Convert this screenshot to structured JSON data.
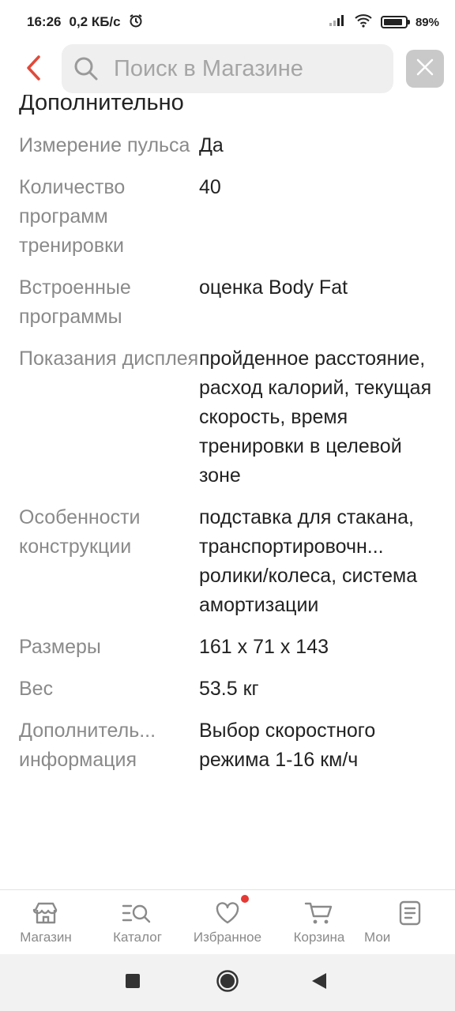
{
  "status_bar": {
    "time": "16:26",
    "net_speed": "0,2 КБ/с",
    "battery": "89%",
    "battery_level": 0.89
  },
  "search": {
    "placeholder": "Поиск в Магазине",
    "value": ""
  },
  "icons": {
    "back": "chevron-left-icon",
    "search": "search-icon",
    "close": "close-icon"
  },
  "colors": {
    "accent": "#e04a3a",
    "label": "#8a8a8a",
    "badge": "#e53935"
  },
  "section": {
    "title": "Дополнительно"
  },
  "specs": [
    {
      "label": "Измерение пульса",
      "value": "Да"
    },
    {
      "label": "Количество программ тренировки",
      "value": "40"
    },
    {
      "label": "Встроенные программы",
      "value": "оценка Body Fat"
    },
    {
      "label": "Показания дисплея",
      "value": "пройденное расстояние, расход калорий, текущая скорость, время тренировки в целевой зоне"
    },
    {
      "label": "Особенности конструкции",
      "value": "подставка для стакана, транспортировочн... ролики/колеса, система амортизации"
    },
    {
      "label": "Размеры",
      "value": "161 x 71 x 143"
    },
    {
      "label": "Вес",
      "value": "53.5 кг"
    },
    {
      "label": "Дополнитель... информация",
      "value": "Выбор скоростного режима 1-16 км/ч"
    }
  ],
  "bottom_nav": [
    {
      "label": "Магазин",
      "icon": "store-icon"
    },
    {
      "label": "Каталог",
      "icon": "catalog-search-icon"
    },
    {
      "label": "Избранное",
      "icon": "heart-icon",
      "badge": true
    },
    {
      "label": "Корзина",
      "icon": "cart-icon"
    },
    {
      "label": "Мои",
      "icon": "orders-icon"
    }
  ],
  "system_nav": [
    "recents-icon",
    "home-icon",
    "back-triangle-icon"
  ]
}
